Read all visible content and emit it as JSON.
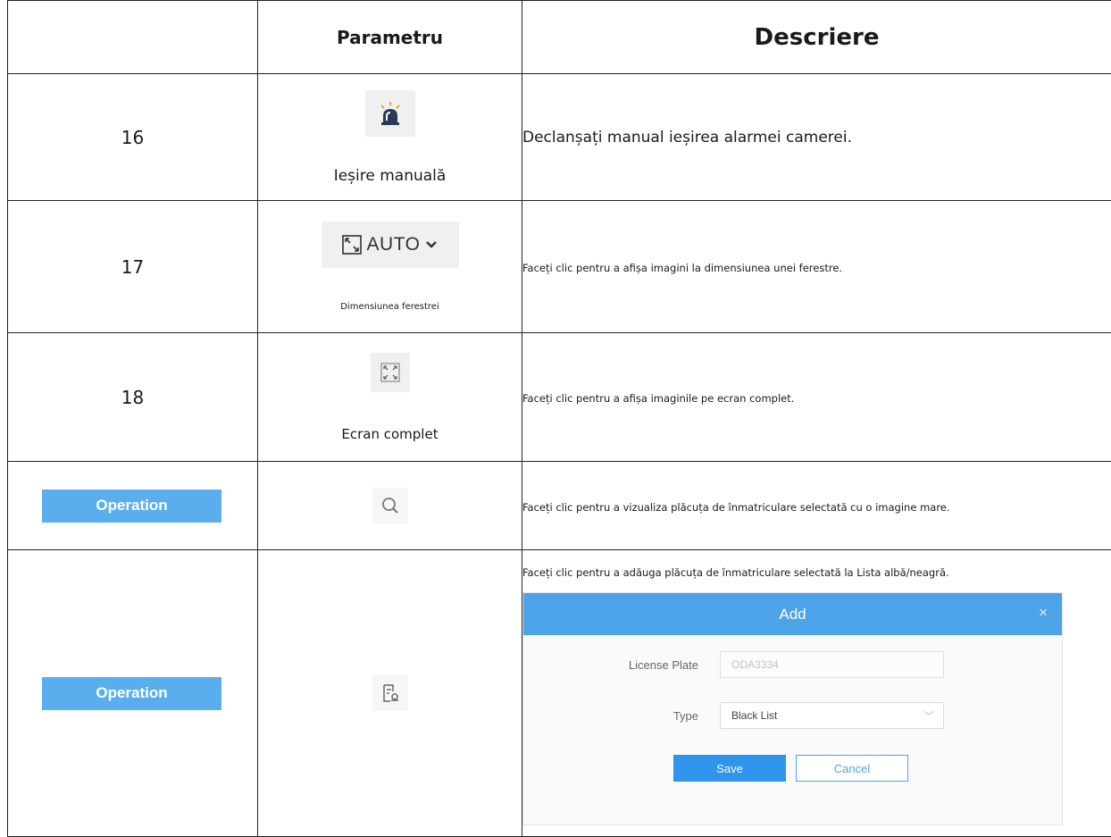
{
  "header": {
    "col1": "",
    "col2": "Parametru",
    "col3": "Descriere"
  },
  "rows": [
    {
      "num": "16",
      "param_label": "Ieșire manuală",
      "icon": "alarm-siren-icon",
      "description": "Declanșați manual ieșirea alarmei camerei."
    },
    {
      "num": "17",
      "param_label": "Dimensiunea ferestrei",
      "icon": "window-size-icon",
      "icon_text": "AUTO",
      "description": "Faceți clic pentru a afișa imagini la dimensiunea unei ferestre."
    },
    {
      "num": "18",
      "param_label": "Ecran complet",
      "icon": "fullscreen-icon",
      "description": "Faceți clic pentru a afișa imaginile pe ecran complet."
    },
    {
      "operation_label": "Operation",
      "icon": "search-icon",
      "description": "Faceți clic pentru a vizualiza plăcuța de înmatriculare selectată cu o imagine mare."
    },
    {
      "operation_label": "Operation",
      "icon": "add-to-list-icon",
      "description": "Faceți clic pentru a adăuga plăcuța de înmatriculare selectată la Lista albă/neagră."
    }
  ],
  "dialog": {
    "title": "Add",
    "close": "×",
    "license_label": "License Plate",
    "license_value": "ODA3334",
    "type_label": "Type",
    "type_value": "Black List",
    "save": "Save",
    "cancel": "Cancel"
  },
  "colors": {
    "operation_button": "#5aaeee",
    "dialog_header": "#4da3e8",
    "save_button": "#2e94ec"
  }
}
